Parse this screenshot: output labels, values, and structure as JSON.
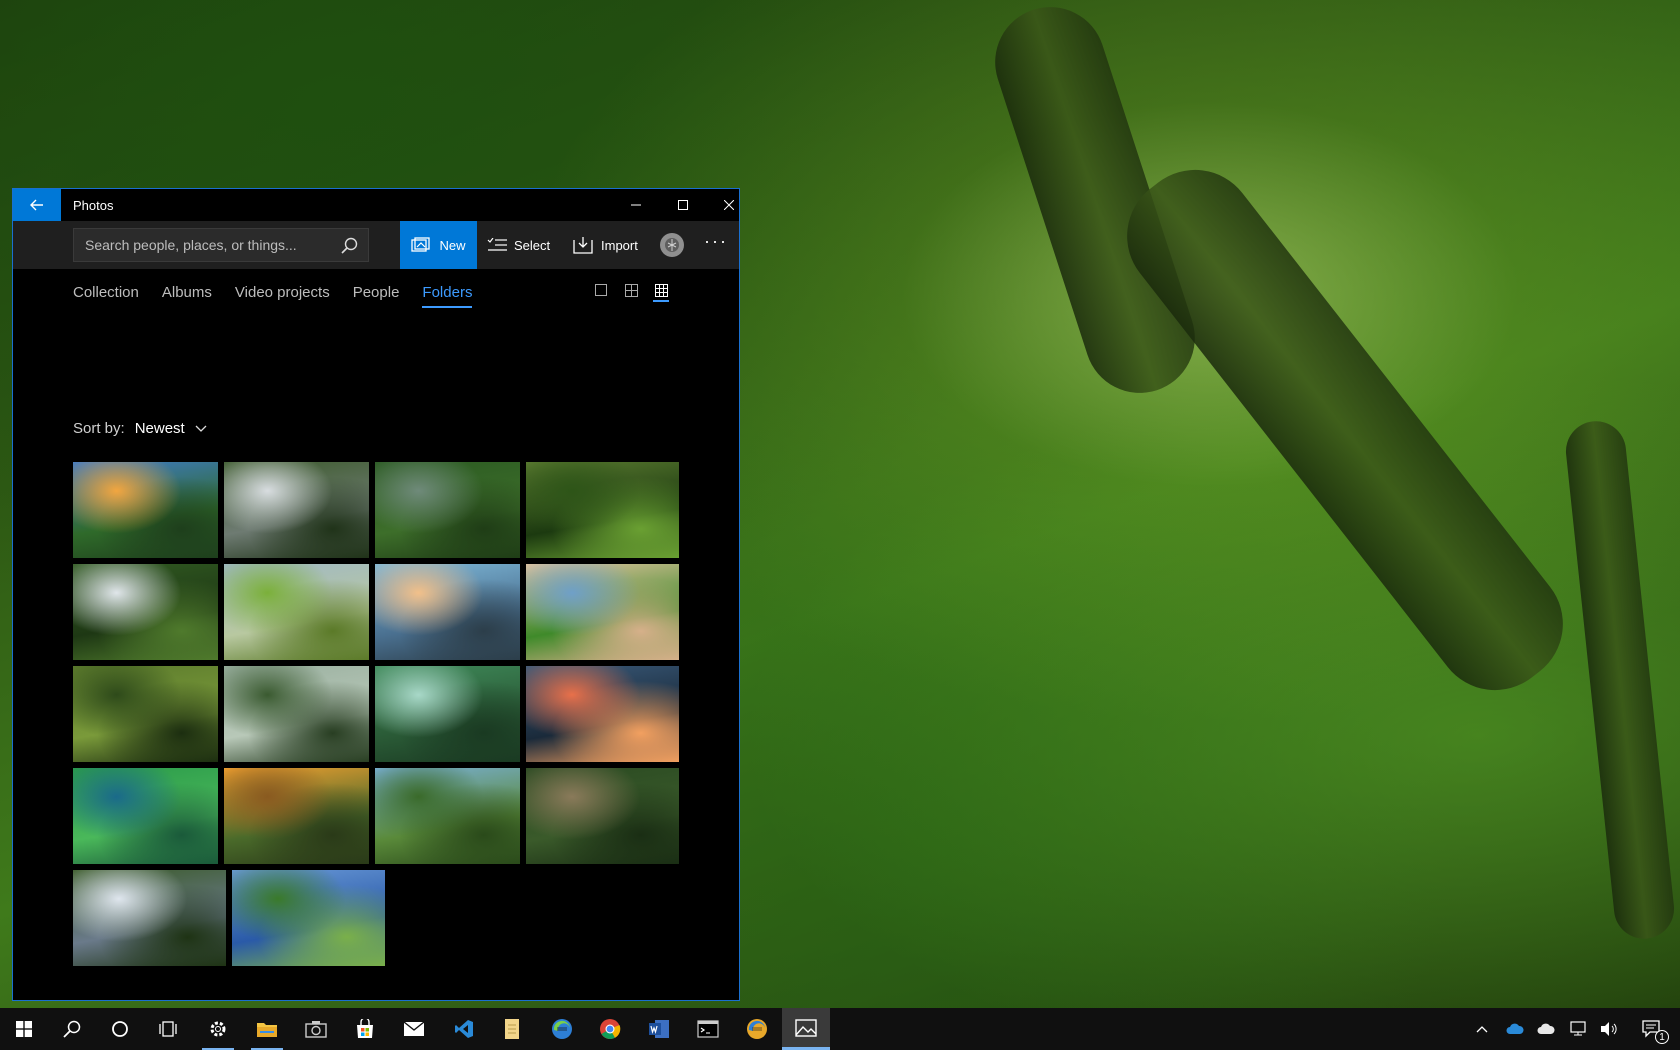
{
  "window": {
    "title": "Photos",
    "search_placeholder": "Search people, places, or things...",
    "toolbar": {
      "new_label": "New",
      "select_label": "Select",
      "import_label": "Import",
      "more_label": "···"
    },
    "tabs": [
      {
        "label": "Collection"
      },
      {
        "label": "Albums"
      },
      {
        "label": "Video projects"
      },
      {
        "label": "People"
      },
      {
        "label": "Folders"
      }
    ],
    "active_tab": "Folders",
    "sort": {
      "label": "Sort by:",
      "value": "Newest"
    }
  },
  "colors": {
    "accent": "#0078d7",
    "active_tab": "#3d9bff",
    "window_bg": "#000000",
    "toolbar_bg": "#1f1f1f",
    "taskbar_bg": "#101010"
  },
  "thumbnails": [
    {
      "name": "sunset-river",
      "colors": [
        "#3f7bc8",
        "#f2a640",
        "#2f6a2a",
        "#1e3f1c"
      ]
    },
    {
      "name": "waterfall-mist",
      "colors": [
        "#3c5a2c",
        "#d8dde0",
        "#6e7b72",
        "#203319"
      ]
    },
    {
      "name": "aerial-river-bends",
      "colors": [
        "#2b5a22",
        "#6f8a7a",
        "#3d6e2a",
        "#1f3d16"
      ]
    },
    {
      "name": "jungle-canopy",
      "colors": [
        "#5a7a30",
        "#2e5518",
        "#1c3a10",
        "#6aa032"
      ]
    },
    {
      "name": "tall-waterfall",
      "colors": [
        "#315a22",
        "#e0e6ea",
        "#1e3814",
        "#4f7a2c"
      ]
    },
    {
      "name": "lily-pads-lake",
      "colors": [
        "#9fb8c6",
        "#7bb03a",
        "#b8c8a0",
        "#5b7a28"
      ]
    },
    {
      "name": "calm-lake-clouds",
      "colors": [
        "#7fb8d8",
        "#f2c08a",
        "#4a7090",
        "#2c3e4a"
      ]
    },
    {
      "name": "sand-dunes-coast",
      "colors": [
        "#e2c4a0",
        "#6fa0c8",
        "#3f8a2a",
        "#d6b08a"
      ]
    },
    {
      "name": "forest-path",
      "colors": [
        "#5b7a2c",
        "#2e4a1a",
        "#7a9a3a",
        "#1c2e10"
      ]
    },
    {
      "name": "lily-pads-hut",
      "colors": [
        "#9ab0a0",
        "#3a5a30",
        "#b8c8b8",
        "#283e22"
      ]
    },
    {
      "name": "forest-sunbeams",
      "colors": [
        "#3f8a5a",
        "#a8d8c8",
        "#2a5a36",
        "#1a3a22"
      ]
    },
    {
      "name": "dusk-river",
      "colors": [
        "#3a5a7a",
        "#e8704a",
        "#1a2a3a",
        "#f2a060"
      ]
    },
    {
      "name": "aerial-tree-tops",
      "colors": [
        "#2a9a4a",
        "#1a6a8a",
        "#4ab85a",
        "#1a5a3a"
      ]
    },
    {
      "name": "golden-sky-canopy",
      "colors": [
        "#f2a030",
        "#8a5a20",
        "#4a6a2a",
        "#2a3a18"
      ]
    },
    {
      "name": "kapok-tree-walkway",
      "colors": [
        "#7ab0d8",
        "#3a6a2a",
        "#5a8a3a",
        "#2a4a1a"
      ]
    },
    {
      "name": "winding-river-aerial",
      "colors": [
        "#2a4a22",
        "#8a7a5a",
        "#3a5a2a",
        "#1a2e14"
      ]
    },
    {
      "name": "rainforest-gorge",
      "colors": [
        "#3a5a28",
        "#dfe6ee",
        "#6a7a8a",
        "#1e3314"
      ]
    },
    {
      "name": "blue-river-jungle",
      "colors": [
        "#6a9ad8",
        "#3a7a2a",
        "#2a5aa8",
        "#7ab04a"
      ]
    }
  ],
  "taskbar": {
    "apps": [
      {
        "name": "start-icon"
      },
      {
        "name": "search-icon"
      },
      {
        "name": "cortana-icon"
      },
      {
        "name": "task-view-icon"
      },
      {
        "name": "settings-icon"
      },
      {
        "name": "file-explorer-icon"
      },
      {
        "name": "camera-icon"
      },
      {
        "name": "store-icon"
      },
      {
        "name": "mail-icon"
      },
      {
        "name": "visual-studio-icon"
      },
      {
        "name": "notepad-icon"
      },
      {
        "name": "edge-beta-icon"
      },
      {
        "name": "chrome-icon"
      },
      {
        "name": "word-icon"
      },
      {
        "name": "terminal-icon"
      },
      {
        "name": "edge-canary-icon"
      },
      {
        "name": "photos-icon"
      }
    ],
    "notification_count": "1"
  }
}
